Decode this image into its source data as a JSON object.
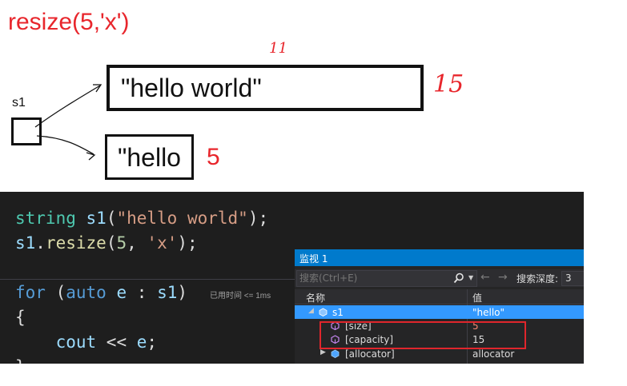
{
  "diagram": {
    "heading": "resize(5,'x')",
    "var_label": "s1",
    "before_text": "\"hello world\"",
    "after_text": "\"hello",
    "note_size_before": "11",
    "note_capacity": "15",
    "note_size_after": "5",
    "accent_color": "#e8262c"
  },
  "code": {
    "line1": {
      "type": "string",
      "var": "s1",
      "open": "(",
      "arg": "\"hello world\"",
      "close": ");"
    },
    "line2": {
      "obj": "s1",
      "dot": ".",
      "method": "resize",
      "open": "(",
      "num": "5",
      "comma": ", ",
      "arg": "'x'",
      "close": ");"
    },
    "line3": {
      "kw": "for",
      "open": " (",
      "auto": "auto",
      "sp": " ",
      "var": "e",
      "colon": " : ",
      "range": "s1",
      "close": ")"
    },
    "perf_hint": "已用时间 <= 1ms",
    "line4": "{",
    "line5": {
      "indent": "    ",
      "ident": "cout",
      "op": " << ",
      "var": "e",
      "end": ";"
    },
    "line6": "}"
  },
  "watch": {
    "title": "监视 1",
    "search_placeholder": "搜索(Ctrl+E)",
    "search_icon": "search-icon",
    "back_icon": "arrow-left-icon",
    "forward_icon": "arrow-right-icon",
    "depth_label": "搜索深度:",
    "depth_value": "3",
    "col_name": "名称",
    "col_value": "值",
    "rows": [
      {
        "name": "s1",
        "value": "\"hello\"",
        "expanded": true,
        "selected": true
      },
      {
        "name": "[size]",
        "value": "5"
      },
      {
        "name": "[capacity]",
        "value": "15"
      },
      {
        "name": "[allocator]",
        "value": "allocator",
        "expanded": false
      }
    ],
    "value_colors": {
      "changed": "#f48771",
      "normal": "#dcdcdc"
    }
  }
}
